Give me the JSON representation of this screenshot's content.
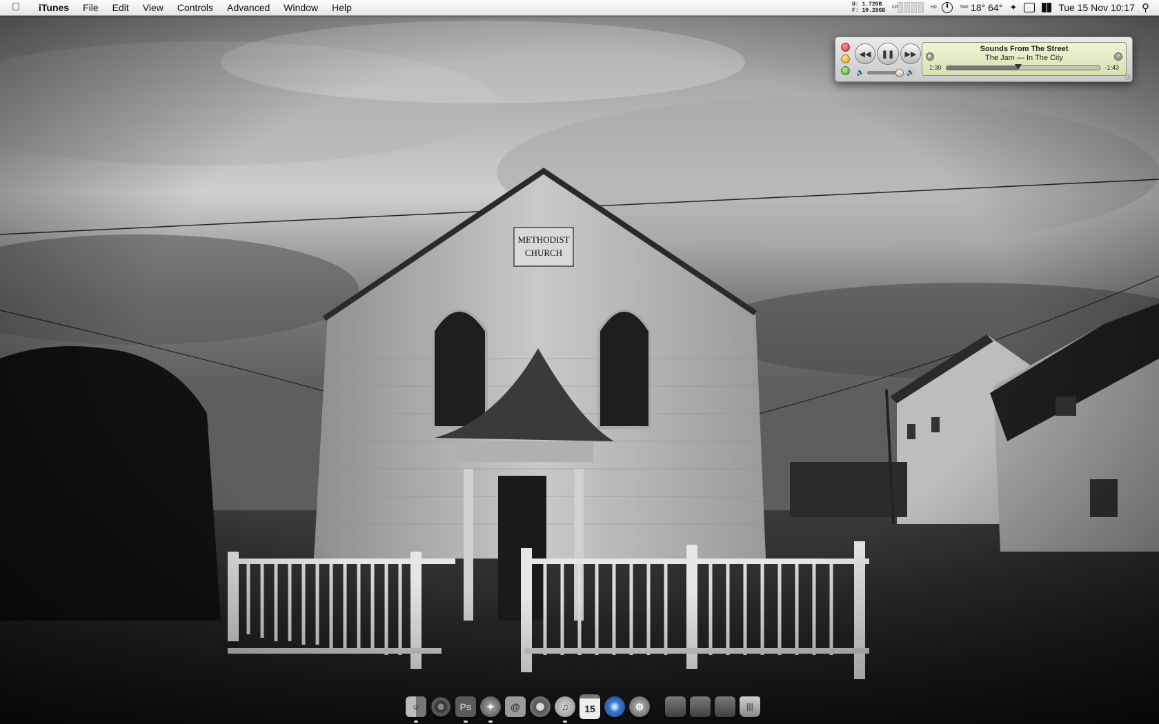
{
  "menubar": {
    "app_name": "iTunes",
    "items": [
      "File",
      "Edit",
      "View",
      "Controls",
      "Advanced",
      "Window",
      "Help"
    ],
    "status": {
      "mem_u_label": "U:",
      "mem_u_value": "1.72GB",
      "mem_f_label": "F:",
      "mem_f_value": "10.28GB",
      "cpu_label": "CPU",
      "hd_label": "HD",
      "temp_label": "TMP",
      "temps": "18° 64°",
      "clock": "Tue 15 Nov  10:17"
    }
  },
  "mini_player": {
    "song_title": "Sounds From The Street",
    "artist_album": "The Jam — In The City",
    "elapsed": "1:30",
    "remaining": "-1:43",
    "progress_fraction": 0.47,
    "volume_fraction": 0.88
  },
  "wallpaper": {
    "sign_line1": "METHODIST",
    "sign_line2": "CHURCH"
  },
  "dock": {
    "calendar_day": "15",
    "photoshop_label": "Ps",
    "mail_symbol": "@",
    "apps": [
      {
        "name": "finder-icon",
        "color": "#8f8f8f"
      },
      {
        "name": "aperture-icon",
        "color": "#4a4a4a"
      },
      {
        "name": "photoshop-icon",
        "color": "#5a5a5a"
      },
      {
        "name": "safari-icon",
        "color": "#6d6d6d"
      },
      {
        "name": "mail-icon",
        "color": "#808080"
      },
      {
        "name": "address-book-icon",
        "color": "#9a9a9a"
      },
      {
        "name": "itunes-icon",
        "color": "#a6a6a6"
      },
      {
        "name": "ical-icon",
        "color": "#e8e8e8"
      },
      {
        "name": "quicksilver-icon",
        "color": "#3a7bd5"
      },
      {
        "name": "system-preferences-icon",
        "color": "#7a7a7a"
      }
    ]
  }
}
